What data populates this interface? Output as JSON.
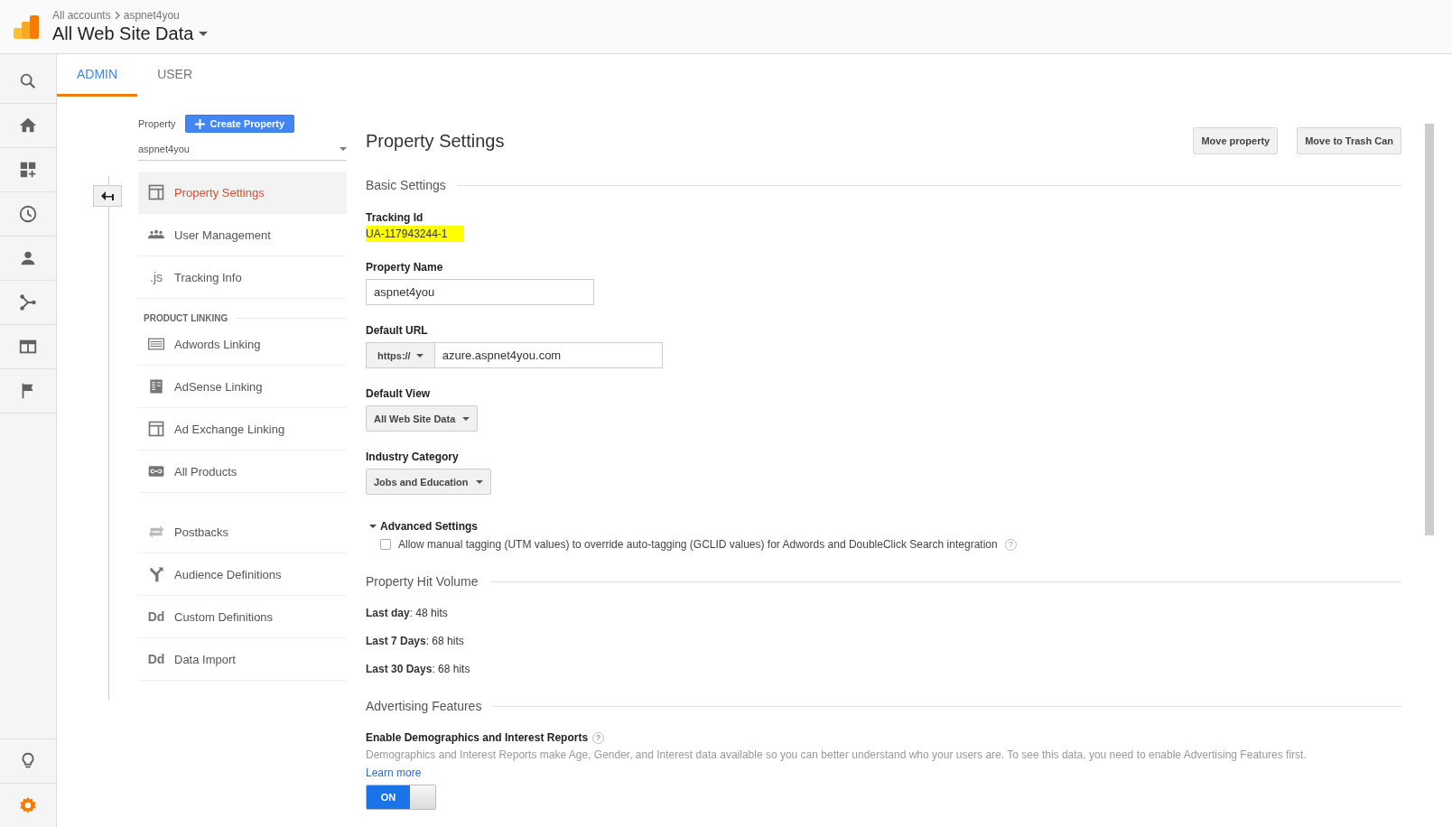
{
  "header": {
    "breadcrumb": [
      "All accounts",
      "aspnet4you"
    ],
    "title": "All Web Site Data"
  },
  "rail": {
    "top": [
      {
        "kind": "search",
        "selected": false
      },
      {
        "kind": "home",
        "selected": false
      },
      {
        "kind": "dashboard",
        "selected": false
      },
      {
        "kind": "clock",
        "selected": false
      },
      {
        "kind": "person",
        "selected": false
      },
      {
        "kind": "branch",
        "selected": false
      },
      {
        "kind": "table",
        "selected": false
      },
      {
        "kind": "flag",
        "selected": false
      }
    ],
    "bottom": [
      {
        "kind": "bulb",
        "selected": false
      },
      {
        "kind": "gear",
        "selected": true
      }
    ]
  },
  "tabs": [
    {
      "label": "ADMIN",
      "selected": true
    },
    {
      "label": "USER",
      "selected": false
    }
  ],
  "property_column": {
    "label": "Property",
    "create_button": "Create Property",
    "selector": "aspnet4you",
    "groups": [
      {
        "items": [
          {
            "label": "Property Settings",
            "kind": "layout",
            "selected": true
          },
          {
            "label": "User Management",
            "kind": "people",
            "selected": false
          },
          {
            "label": "Tracking Info",
            "kind": "glyph",
            "glyph": ".js",
            "selected": false
          }
        ]
      },
      {
        "heading": "PRODUCT LINKING",
        "items": [
          {
            "label": "Adwords Linking",
            "kind": "lines",
            "selected": false
          },
          {
            "label": "AdSense Linking",
            "kind": "sheet",
            "selected": false
          },
          {
            "label": "Ad Exchange Linking",
            "kind": "layout",
            "selected": false
          },
          {
            "label": "All Products",
            "kind": "link",
            "selected": false
          }
        ]
      },
      {
        "items": [
          {
            "label": "Postbacks",
            "kind": "swap",
            "selected": false
          },
          {
            "label": "Audience Definitions",
            "kind": "fork",
            "selected": false
          },
          {
            "label": "Custom Definitions",
            "kind": "glyph",
            "glyph": "Dd",
            "selected": false
          },
          {
            "label": "Data Import",
            "kind": "glyph",
            "glyph": "Dd",
            "selected": false
          }
        ]
      }
    ]
  },
  "main": {
    "title": "Property Settings",
    "actions": [
      "Move property",
      "Move to Trash Can"
    ],
    "basic": {
      "heading": "Basic Settings",
      "fields": [
        {
          "kind": "highlight",
          "label": "Tracking Id",
          "value": "UA-117943244-1"
        },
        {
          "kind": "input",
          "label": "Property Name",
          "value": "aspnet4you"
        },
        {
          "kind": "url",
          "label": "Default URL",
          "prefix": "https://",
          "value": "azure.aspnet4you.com"
        },
        {
          "kind": "dropdown",
          "label": "Default View",
          "value": "All Web Site Data"
        },
        {
          "kind": "dropdown",
          "label": "Industry Category",
          "value": "Jobs and Education"
        }
      ]
    },
    "advanced": {
      "label": "Advanced Settings",
      "expanded": true,
      "options": [
        {
          "label": "Allow manual tagging (UTM values) to override auto-tagging (GCLID values) for Adwords and DoubleClick Search integration",
          "checked": false,
          "help": "?"
        }
      ]
    },
    "hit_volume": {
      "heading": "Property Hit Volume",
      "rows": [
        "**Last day**: 48 hits",
        "**Last 7 Days**: 68 hits",
        "**Last 30 Days**: 68 hits"
      ]
    },
    "advertising": {
      "heading": "Advertising Features",
      "items": [
        {
          "title": "Enable Demographics and Interest Reports",
          "help": "?",
          "description": "Demographics and Interest Reports make Age, Gender, and Interest data available so you can better understand who your users are. To see this data, you need to enable Advertising Features first.",
          "link": "Learn more",
          "toggle": {
            "label": "ON",
            "on": true
          }
        }
      ]
    }
  }
}
